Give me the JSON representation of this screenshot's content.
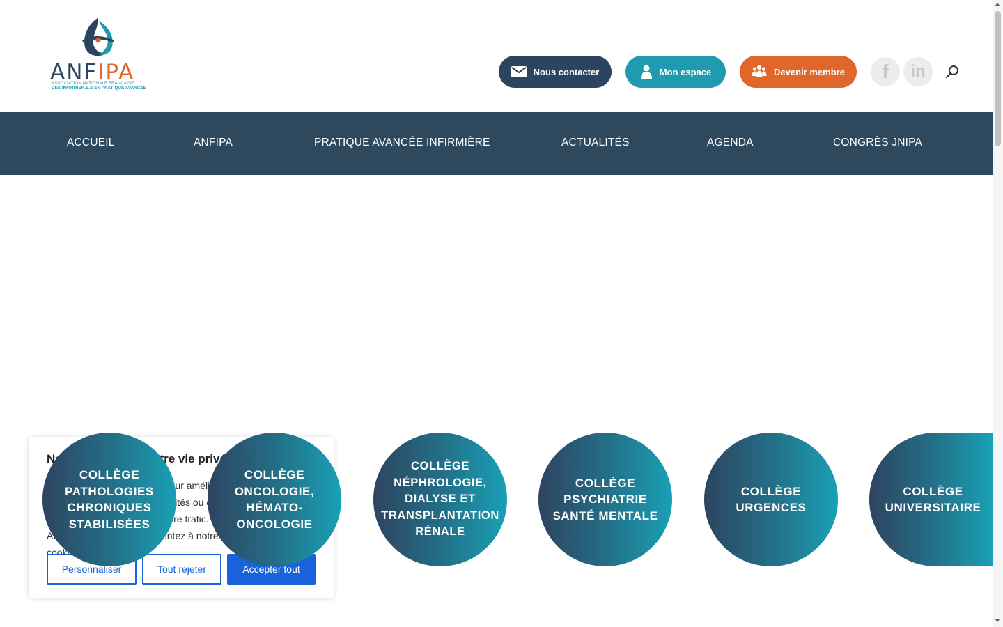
{
  "header": {
    "logo": {
      "word_part1": "ANF",
      "word_part2": "IPA",
      "subtitle_line1": "Association Nationale Française",
      "subtitle_line2": "des infirmier.e.s en pratique avancée"
    },
    "buttons": {
      "contact": "Nous contacter",
      "espace": "Mon espace",
      "membre": "Devenir membre"
    },
    "social": {
      "facebook": "f",
      "linkedin": "in"
    }
  },
  "nav": {
    "items": [
      "ACCUEIL",
      "ANFIPA",
      "PRATIQUE AVANCÉE INFIRMIÈRE",
      "ACTUALITÉS",
      "AGENDA",
      "CONGRÈS JNIPA"
    ]
  },
  "cookie": {
    "title": "Nous respectons votre vie privée",
    "text": "Nous utilisons des cookies pour améliorer votre expérience de navigation, diffuser des publicités ou des contenus personnalisés et analyser notre trafic. En cliquant sur « Accepter tout », vous consentez à notre utilisation des cookies.",
    "customize": "Personnaliser",
    "reject": "Tout rejeter",
    "accept": "Accepter tout"
  },
  "colleges": [
    "Collège pathologies chroniques stabilisées",
    "Collège oncologie, hémato-oncologie",
    "Collège néphrologie, dialyse et transplantation rénale",
    "Collège psychiatrie santé mentale",
    "Collège urgences",
    "Collège universitaire"
  ],
  "colors": {
    "navy": "#2b4560",
    "teal": "#1f9bb0",
    "orange": "#e0662b",
    "nav_bg": "#2e485e",
    "cookie_blue": "#1863dc"
  },
  "icons": [
    "envelope-icon",
    "user-icon",
    "group-icon",
    "facebook-icon",
    "linkedin-icon",
    "search-icon"
  ]
}
